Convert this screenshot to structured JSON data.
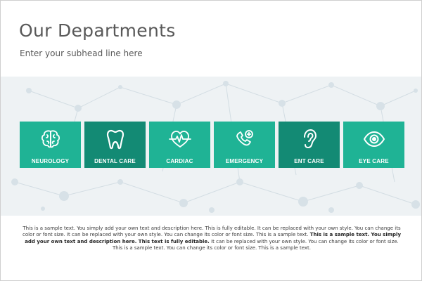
{
  "header": {
    "title": "Our Departments",
    "subhead": "Enter your subhead line here"
  },
  "colors": {
    "card_light": "#1fb395",
    "card_dark": "#138a74",
    "band_background": "#eef2f4",
    "title_text": "#595959"
  },
  "departments": [
    {
      "label": "NEUROLOGY",
      "icon": "brain-icon",
      "shade": "light"
    },
    {
      "label": "DENTAL CARE",
      "icon": "tooth-icon",
      "shade": "dark"
    },
    {
      "label": "CARDIAC",
      "icon": "heart-pulse-icon",
      "shade": "light"
    },
    {
      "label": "EMERGENCY",
      "icon": "phone-plus-icon",
      "shade": "light"
    },
    {
      "label": "ENT CARE",
      "icon": "ear-icon",
      "shade": "dark"
    },
    {
      "label": "EYE CARE",
      "icon": "eye-icon",
      "shade": "light"
    }
  ],
  "body": {
    "text_1": "This is a sample text. You simply add your own text and description here. This is fully editable. It can be replaced with your own style. You can change its color or font size. It can be replaced with your own style. You can change its color or font size. This is a sample text.",
    "text_bold": "This is a sample text. You simply add your own text and description here. This text is fully editable.",
    "text_2": "It can be replaced with your own style. You can change its color or font size. This is a sample text. You can change its color or font size. This is a sample text."
  }
}
